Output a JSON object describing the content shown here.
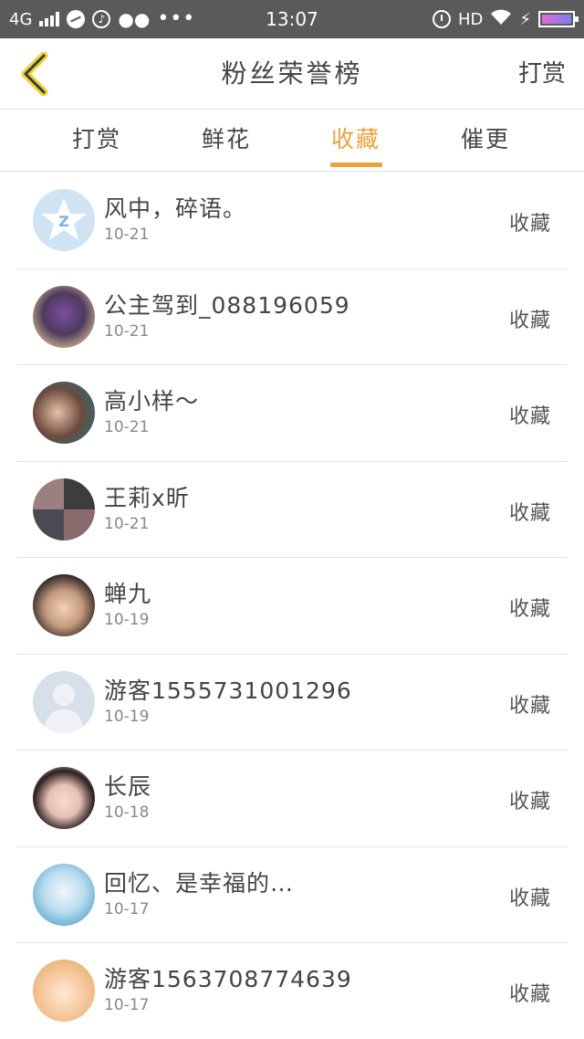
{
  "status_bar": {
    "network": "4G",
    "time": "13:07",
    "hd": "HD",
    "icons": [
      "signal-icon",
      "browser-icon",
      "music-icon",
      "wechat-icon",
      "more-dots-icon",
      "alarm-icon",
      "wifi-icon",
      "charging-icon",
      "battery-icon"
    ]
  },
  "header": {
    "title": "粉丝荣誉榜",
    "action_label": "打赏",
    "back_icon": "chevron-left-icon",
    "accent_color": "#e9a33a"
  },
  "tabs": [
    {
      "label": "打赏",
      "active": false
    },
    {
      "label": "鲜花",
      "active": false
    },
    {
      "label": "收藏",
      "active": true
    },
    {
      "label": "催更",
      "active": false
    }
  ],
  "list": [
    {
      "name": "风中，碎语。",
      "date": "10-21",
      "action": "收藏"
    },
    {
      "name": "公主驾到_088196059",
      "date": "10-21",
      "action": "收藏"
    },
    {
      "name": "高小样～",
      "date": "10-21",
      "action": "收藏"
    },
    {
      "name": "王莉x昕",
      "date": "10-21",
      "action": "收藏"
    },
    {
      "name": "蝉九",
      "date": "10-19",
      "action": "收藏"
    },
    {
      "name": "游客1555731001296",
      "date": "10-19",
      "action": "收藏"
    },
    {
      "name": "长辰",
      "date": "10-18",
      "action": "收藏"
    },
    {
      "name": "回忆、是幸福的…",
      "date": "10-17",
      "action": "收藏"
    },
    {
      "name": "游客1563708774639",
      "date": "10-17",
      "action": "收藏"
    }
  ]
}
